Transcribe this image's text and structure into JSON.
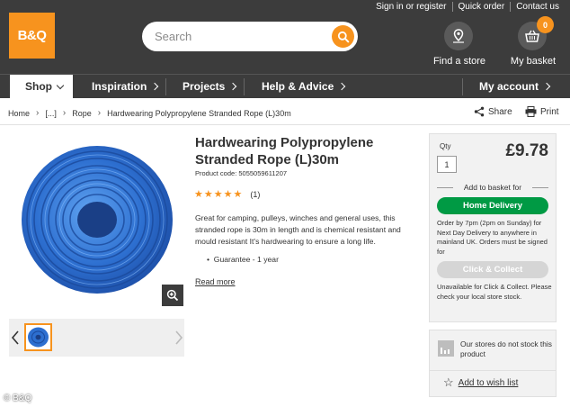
{
  "brand": {
    "logo_text": "B&Q",
    "accent_color": "#f7931e",
    "header_bg": "#3c3c3c"
  },
  "top_links": [
    "Sign in or register",
    "Quick order",
    "Contact us"
  ],
  "search": {
    "placeholder": "Search",
    "icon": "search-icon"
  },
  "header_actions": {
    "find_store": "Find a store",
    "basket": "My basket",
    "basket_count": "0"
  },
  "nav": {
    "shop": "Shop",
    "inspiration": "Inspiration",
    "projects": "Projects",
    "help": "Help & Advice",
    "account": "My account"
  },
  "breadcrumb": [
    "Home",
    "[...]",
    "Rope",
    "Hardwearing Polypropylene Stranded Rope (L)30m"
  ],
  "page_actions": {
    "share": "Share",
    "print": "Print"
  },
  "product": {
    "title": "Hardwearing Polypropylene Stranded Rope (L)30m",
    "product_code": "Product code: 5055059611207",
    "rating_stars": 5,
    "review_count": "(1)",
    "description": "Great for camping, pulleys, winches and general uses, this stranded rope is 30m in length and is chemical resistant and mould resistant It's hardwearing to ensure a long life.",
    "bullet": "Guarantee - 1 year",
    "read_more": "Read more"
  },
  "purchase": {
    "qty_label": "Qty",
    "qty_value": "1",
    "price": "£9.78",
    "add_to_basket_label": "Add to basket for",
    "home_delivery": "Home Delivery",
    "delivery_info": "Order by 7pm (2pm on Sunday) for Next Day Delivery to anywhere in mainland UK. Orders must be signed for",
    "click_collect": "Click & Collect",
    "unavailable_info": "Unavailable for Click & Collect. Please check your local store stock.",
    "green_color": "#009a44"
  },
  "stores": {
    "stock_text": "Our stores do not stock this product",
    "wishlist": "Add to wish list"
  },
  "credit": "© B&Q"
}
